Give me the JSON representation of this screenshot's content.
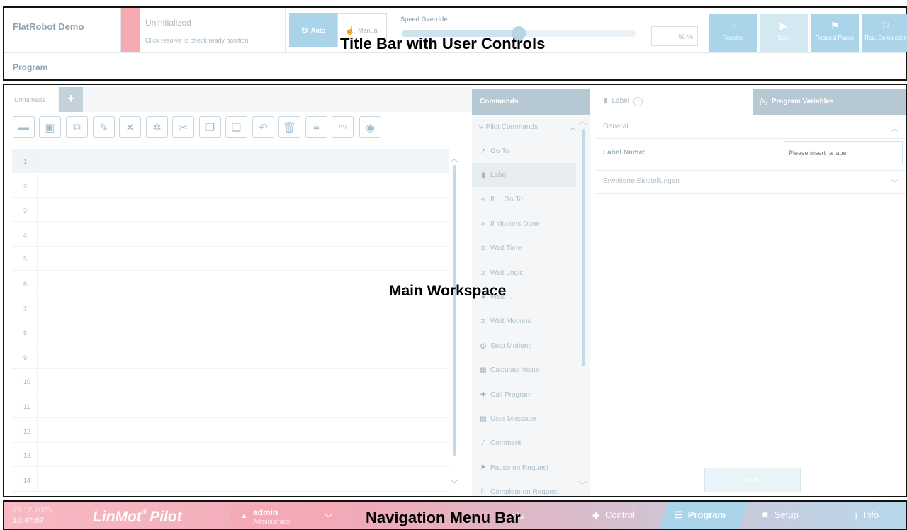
{
  "title_bar": {
    "app_name": "FlatRobot Demo",
    "status_title": "Uninitialized",
    "status_hint": "Click resolve to check ready position",
    "mode_auto": "Auto",
    "mode_manual": "Manual",
    "speed_label": "Speed Override",
    "speed_value": "50 %",
    "speed_fraction": 0.5,
    "buttons": {
      "resolve": "Resolve",
      "start": "Start",
      "request_pause": "Request Pause",
      "req_completion": "Req. Completion"
    },
    "program_label": "Program"
  },
  "editor": {
    "tab_name": "Unnamed1",
    "add_tab": "+",
    "line_numbers": [
      "1",
      "2",
      "3",
      "4",
      "5",
      "6",
      "7",
      "8",
      "9",
      "10",
      "11",
      "12",
      "13",
      "14"
    ],
    "toolbar_comment_icon": "/**/"
  },
  "commands": {
    "header": "Commands",
    "group": "Pilot Commands",
    "items": [
      {
        "label": "Go To",
        "icon": "goto-icon"
      },
      {
        "label": "Label",
        "icon": "label-icon"
      },
      {
        "label": "If ... Go To ...",
        "icon": "if-goto-icon"
      },
      {
        "label": "If Motions Done",
        "icon": "if-motions-icon"
      },
      {
        "label": "Wait Time",
        "icon": "wait-time-icon"
      },
      {
        "label": "Wait Logic",
        "icon": "wait-logic-icon"
      },
      {
        "label": "Wait ...",
        "icon": "wait-icon"
      },
      {
        "label": "Wait Motions",
        "icon": "wait-motions-icon"
      },
      {
        "label": "Stop Motions",
        "icon": "stop-motions-icon"
      },
      {
        "label": "Calculate Value",
        "icon": "calculate-icon"
      },
      {
        "label": "Call Program",
        "icon": "call-program-icon"
      },
      {
        "label": "User Message",
        "icon": "user-message-icon"
      },
      {
        "label": "Comment",
        "icon": "comment-icon"
      },
      {
        "label": "Pause on Request",
        "icon": "pause-request-icon"
      },
      {
        "label": "Complete on Request",
        "icon": "complete-request-icon"
      }
    ]
  },
  "properties": {
    "tab_label": "Label",
    "tab_variables": "Program Variables",
    "variables_icon": "{x}",
    "general": "General",
    "label_name": "Label Name:",
    "label_placeholder": "Please insert  a label",
    "advanced": "Erweiterte Einstellungen",
    "insert": "Insert"
  },
  "nav": {
    "date": "29.12.2025",
    "time": "10:47:57",
    "logo_main": "LinMot",
    "logo_reg": "®",
    "logo_sub": "Pilot",
    "user_name": "admin",
    "user_role": "Administrator",
    "items": {
      "hidden_left": "...",
      "events": "nts",
      "control": "Control",
      "program": "Program",
      "setup": "Setup",
      "info": "Info"
    }
  },
  "overlays": {
    "title_bar": "Title Bar with User Controls",
    "main": "Main Workspace",
    "nav": "Navigation Menu Bar"
  },
  "colors": {
    "accent": "#a9d4ea",
    "status_red": "#f6aab1",
    "nav_gradient_start": "#f7b9c3",
    "nav_gradient_end": "#b7d8eb"
  }
}
